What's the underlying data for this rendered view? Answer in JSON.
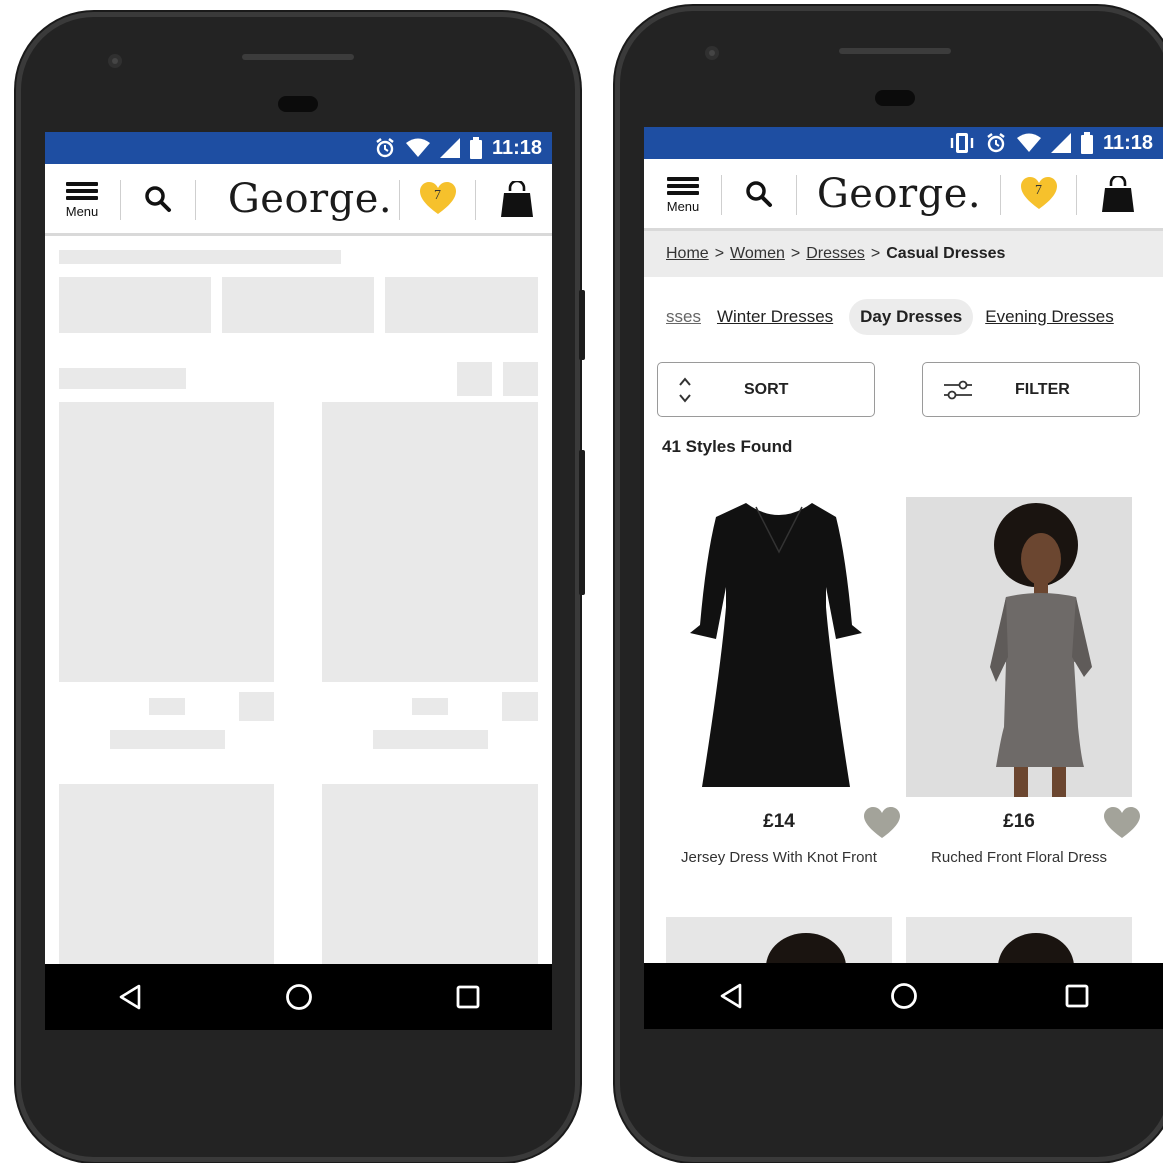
{
  "status_bar": {
    "time": "11:18",
    "icons": [
      "vibrate-icon",
      "alarm-icon",
      "wifi-icon",
      "signal-icon",
      "battery-icon"
    ]
  },
  "header": {
    "menu_label": "Menu",
    "logo_text": "George.",
    "wishlist_count": "7",
    "brand_colors": {
      "statusbar": "#1e4ea2",
      "heart": "#f6c12c"
    }
  },
  "breadcrumb": {
    "items": [
      "Home",
      "Women",
      "Dresses"
    ],
    "current": "Casual Dresses",
    "separator": ">"
  },
  "category_chips": {
    "items": [
      "sses",
      "Winter Dresses",
      "Evening Dresses"
    ],
    "active": "Day Dresses"
  },
  "controls": {
    "sort_label": "SORT",
    "filter_label": "FILTER"
  },
  "results_text": "41 Styles Found",
  "products": [
    {
      "price": "£14",
      "name": "Jersey Dress With Knot Front"
    },
    {
      "price": "£16",
      "name": "Ruched Front Floral Dress"
    }
  ]
}
